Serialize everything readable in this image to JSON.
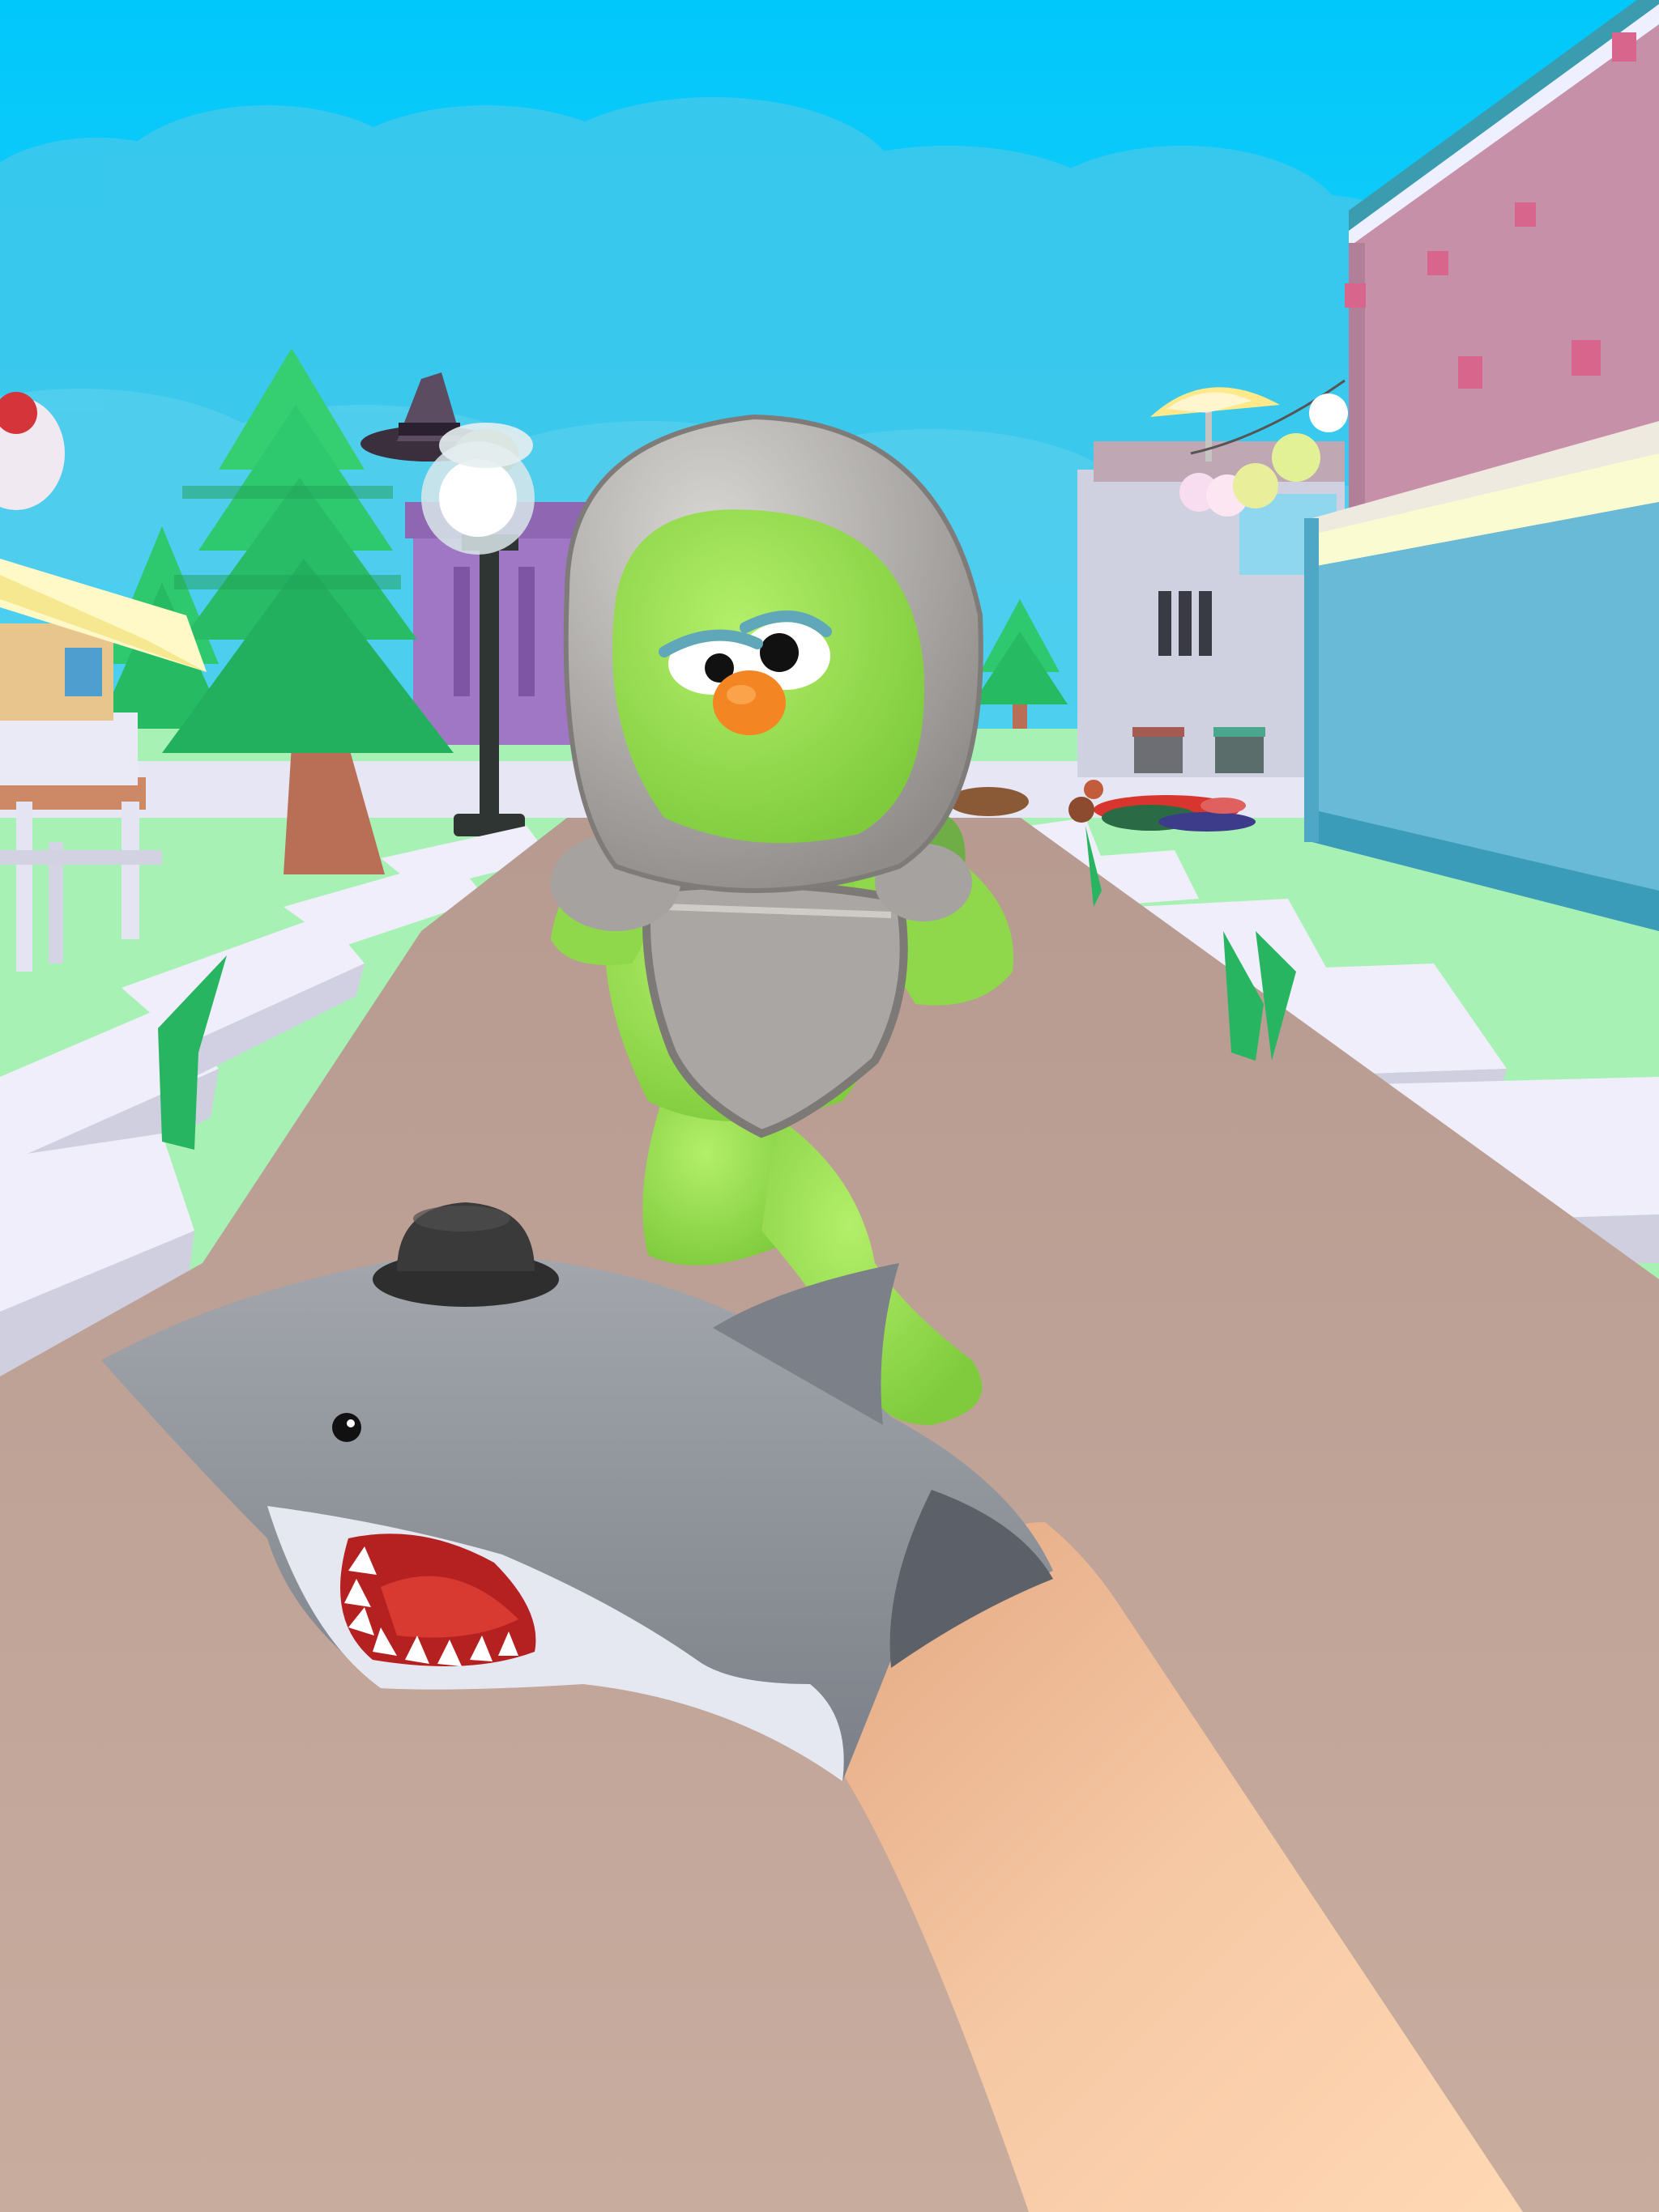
{
  "screen": {
    "title": "",
    "hud_visible": false
  },
  "scene": {
    "view": "first-person",
    "setting": "town-street",
    "elements": [
      "sky-clouds",
      "pine-tree",
      "street-lamp",
      "purple-building",
      "witch-hat",
      "pink-building",
      "blue-building",
      "grey-building",
      "beach-umbrella",
      "hanging-lanterns",
      "park-bench",
      "grass-lawn",
      "stone-curbs",
      "dirt-path",
      "knocked-down-npcs",
      "green-creature-enemy",
      "knight-helmet",
      "chest-armor",
      "shark-hand-puppet",
      "bowler-hat",
      "player-arm"
    ]
  },
  "palette": {
    "sky": "#12cbf6",
    "cloud": "#3fc9ec",
    "grass": "#a6f0b4",
    "path": "#c3a79c",
    "curb": "#eeeefa",
    "tree": "#2ec86f",
    "trunk": "#b86f55",
    "creature": "#98e04e",
    "armor": "#a5a2a0",
    "shark": "#8e9299",
    "skin": "#f2c3a0",
    "pink_wall": "#c68fa7",
    "blue_wall": "#67b9d6"
  }
}
